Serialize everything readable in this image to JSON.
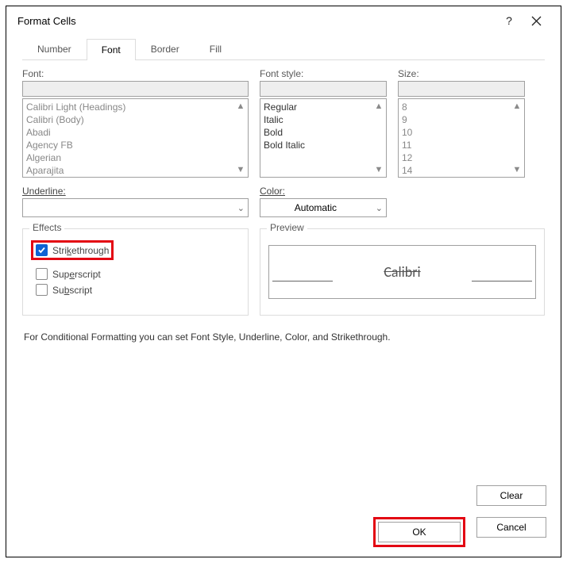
{
  "dialog": {
    "title": "Format Cells"
  },
  "tabs": {
    "number": "Number",
    "font": "Font",
    "border": "Border",
    "fill": "Fill"
  },
  "font": {
    "label": "Font:",
    "items": [
      "Calibri Light (Headings)",
      "Calibri (Body)",
      "Abadi",
      "Agency FB",
      "Algerian",
      "Aparajita"
    ]
  },
  "fontStyle": {
    "label": "Font style:",
    "items": [
      "Regular",
      "Italic",
      "Bold",
      "Bold Italic"
    ]
  },
  "size": {
    "label": "Size:",
    "items": [
      "8",
      "9",
      "10",
      "11",
      "12",
      "14"
    ]
  },
  "underline": {
    "label": "Underline:",
    "value": ""
  },
  "color": {
    "label": "Color:",
    "value": "Automatic"
  },
  "effects": {
    "legend": "Effects",
    "strikethrough": {
      "label": "Strikethrough",
      "checked": true
    },
    "superscript": {
      "label": "Superscript",
      "checked": false
    },
    "subscript": {
      "label": "Subscript",
      "checked": false
    }
  },
  "preview": {
    "legend": "Preview",
    "text": "Calibri"
  },
  "note": "For Conditional Formatting you can set Font Style, Underline, Color, and Strikethrough.",
  "buttons": {
    "clear": "Clear",
    "ok": "OK",
    "cancel": "Cancel"
  },
  "glyphs": {
    "up": "▲",
    "down": "▼",
    "chev": "⌄",
    "help": "?"
  }
}
